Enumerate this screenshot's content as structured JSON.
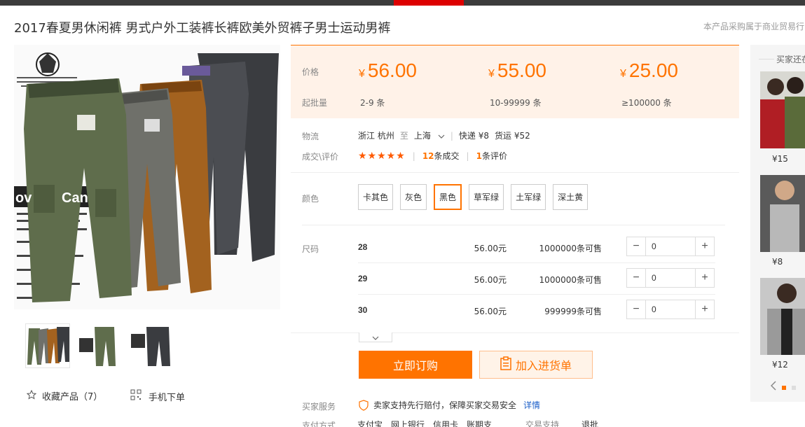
{
  "title": "2017春夏男休闲裤 男式户外工装裤长裤欧美外贸裤子男士运动男裤",
  "notice": "本产品采购属于商业贸易行",
  "price_box": {
    "price_label": "价格",
    "moq_label": "起批量",
    "currency": "¥",
    "tiers": [
      {
        "price": "56.00",
        "range": "2-9 条"
      },
      {
        "price": "55.00",
        "range": "10-99999 条"
      },
      {
        "price": "25.00",
        "range": "≥100000 条"
      }
    ]
  },
  "logistics": {
    "label": "物流",
    "origin": "浙江 杭州",
    "to": "至",
    "dest": "上海",
    "express": "快递 ¥8",
    "freight": "货运 ¥52"
  },
  "trade": {
    "label": "成交\\评价",
    "stars": "★★★★★",
    "deals_num": "12",
    "deals_text": "条成交",
    "reviews_num": "1",
    "reviews_text": "条评价"
  },
  "color": {
    "label": "颜色",
    "options": [
      "卡其色",
      "灰色",
      "黑色",
      "草军绿",
      "土军绿",
      "深土黄"
    ],
    "selected": "黑色"
  },
  "sizes": {
    "label": "尺码",
    "rows": [
      {
        "size": "28",
        "price": "56.00元",
        "stock": "1000000条可售",
        "qty": "0"
      },
      {
        "size": "29",
        "price": "56.00元",
        "stock": "1000000条可售",
        "qty": "0"
      },
      {
        "size": "30",
        "price": "56.00元",
        "stock": "999999条可售",
        "qty": "0"
      }
    ]
  },
  "buttons": {
    "order": "立即订购",
    "cart": "加入进货单"
  },
  "service": {
    "label": "买家服务",
    "badge": "保",
    "text": "卖家支持先行赔付，保障买家交易安全",
    "link": "详情"
  },
  "payment": {
    "label": "支付方式",
    "methods": [
      "支付宝",
      "网上银行",
      "信用卡",
      "账期支"
    ],
    "trade_support_label": "交易支持",
    "trade_support": "退批"
  },
  "left": {
    "favorite": "收藏产品（7）",
    "mobile": "手机下单"
  },
  "sidebar": {
    "title": "买家还在",
    "prices": [
      "¥15",
      "¥8",
      "¥12"
    ]
  },
  "colors": {
    "accent": "#ff7300",
    "topbar": "#3c3c3c",
    "topbar_accent": "#dd0000",
    "price_bg": "#fff2e8"
  }
}
